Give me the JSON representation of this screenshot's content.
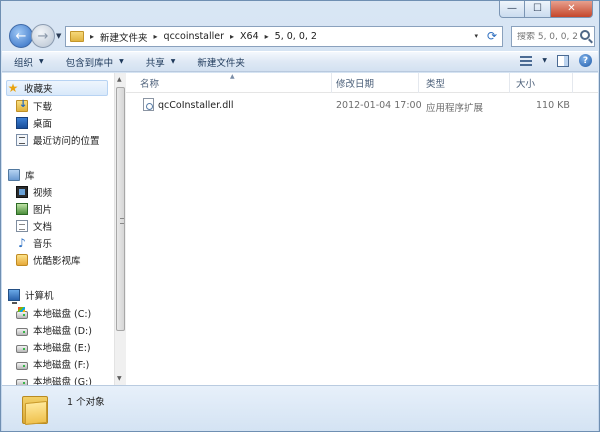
{
  "window": {
    "caption_buttons": {
      "minimize": "—",
      "maximize": "☐",
      "close": "✕"
    }
  },
  "address_bar": {
    "breadcrumbs": [
      "新建文件夹",
      "qccoinstaller",
      "X64",
      "5, 0, 0, 2"
    ],
    "separator": "▸",
    "dropdown": "▾",
    "refresh": "⟳"
  },
  "search": {
    "placeholder": "搜索 5, 0, 0, 2"
  },
  "toolbar": {
    "organize": "组织",
    "include_in_library": "包含到库中",
    "share": "共享",
    "new_folder": "新建文件夹",
    "caret": "▼",
    "help": "?"
  },
  "nav_pane": {
    "favorites": {
      "label": "收藏夹",
      "items": [
        {
          "label": "下载",
          "icon": "download-folder-icon"
        },
        {
          "label": "桌面",
          "icon": "desktop-icon"
        },
        {
          "label": "最近访问的位置",
          "icon": "recent-places-icon"
        }
      ]
    },
    "libraries": {
      "label": "库",
      "items": [
        {
          "label": "视频",
          "icon": "videos-icon"
        },
        {
          "label": "图片",
          "icon": "pictures-icon"
        },
        {
          "label": "文档",
          "icon": "documents-icon"
        },
        {
          "label": "音乐",
          "icon": "music-icon"
        },
        {
          "label": "优酷影视库",
          "icon": "youku-library-icon"
        }
      ]
    },
    "computer": {
      "label": "计算机",
      "drives": [
        {
          "label": "本地磁盘 (C:)"
        },
        {
          "label": "本地磁盘 (D:)"
        },
        {
          "label": "本地磁盘 (E:)"
        },
        {
          "label": "本地磁盘 (F:)"
        },
        {
          "label": "本地磁盘 (G:)"
        }
      ]
    }
  },
  "file_list": {
    "columns": {
      "name": "名称",
      "modified": "修改日期",
      "type": "类型",
      "size": "大小"
    },
    "sort_indicator": "▲",
    "rows": [
      {
        "name": "qcCoInstaller.dll",
        "modified": "2012-01-04 17:00",
        "type": "应用程序扩展",
        "size": "110 KB"
      }
    ]
  },
  "details_pane": {
    "count": "1 个对象"
  }
}
